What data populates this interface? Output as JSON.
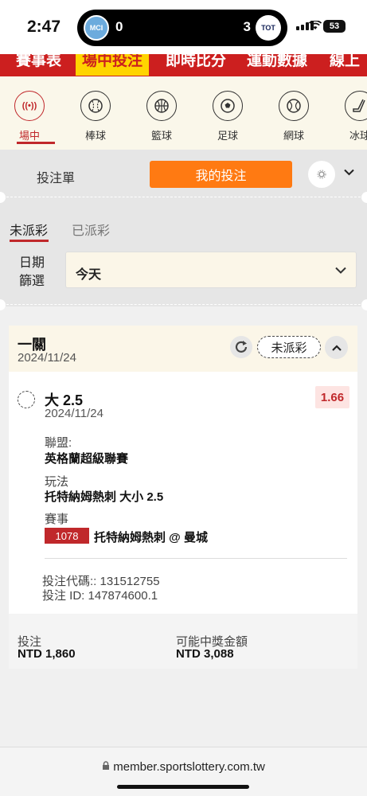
{
  "status_bar": {
    "time": "2:47",
    "home_club": "MCI",
    "home_score": "0",
    "away_score": "3",
    "away_club": "TOT",
    "battery": "53"
  },
  "top_nav": [
    "賽事表",
    "場中投注",
    "即時比分",
    "運動數據",
    "線上"
  ],
  "top_nav_active": 1,
  "sports": [
    {
      "label": "場中",
      "icon": "live-broadcast-icon",
      "glyph": "((•))"
    },
    {
      "label": "棒球",
      "icon": "baseball-icon",
      "glyph": "⚾"
    },
    {
      "label": "籃球",
      "icon": "basketball-icon",
      "glyph": "🏀"
    },
    {
      "label": "足球",
      "icon": "soccer-ball-icon",
      "glyph": "⚽"
    },
    {
      "label": "網球",
      "icon": "tennis-ball-icon",
      "glyph": "🎾"
    },
    {
      "label": "冰球",
      "icon": "ice-hockey-icon",
      "glyph": "🏒"
    }
  ],
  "bet_tabs": {
    "slip": "投注單",
    "my_bets": "我的投注"
  },
  "filter": {
    "tabs": [
      "未派彩",
      "已派彩"
    ],
    "date_label": "日期\n篩選",
    "date_value": "今天"
  },
  "card": {
    "title": "一關",
    "date": "2024/11/24",
    "status": "未派彩",
    "pick": "大 2.5",
    "pick_date": "2024/11/24",
    "odds": "1.66",
    "league_label": "聯盟:",
    "league": "英格蘭超級聯賽",
    "market_label": "玩法",
    "market": "托特納姆熱刺 大小 2.5",
    "match_label": "賽事",
    "match_code": "1078",
    "match": "托特納姆熱刺 @ 曼城",
    "bet_code": "投注代碼:: 131512755",
    "bet_id": "投注 ID: 147874600.1",
    "stake_label": "投注",
    "stake": "NTD 1,860",
    "payout_label": "可能中獎金額",
    "payout": "NTD 3,088"
  },
  "browser": {
    "url": "member.sportslottery.com.tw"
  },
  "colors": {
    "brand_red": "#cc1f1f",
    "accent_orange": "#ff7a12",
    "highlight_yellow": "#ffd400",
    "cream": "#faf7ea"
  }
}
